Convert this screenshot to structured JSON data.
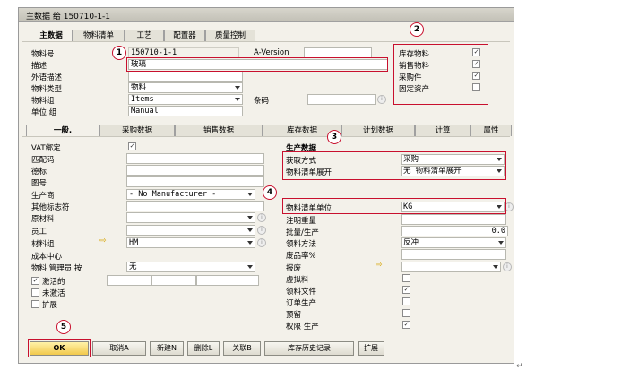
{
  "window": {
    "title": "主数据 给 150710-1-1"
  },
  "main_tabs": [
    "主数据",
    "物料清单",
    "工艺",
    "配置器",
    "质量控制"
  ],
  "header": {
    "item_no_label": "物料号",
    "item_no_value": "150710-1-1",
    "version_label": "A-Version",
    "desc_label": "描述",
    "desc_value": "玻璃",
    "foreign_desc_label": "外语描述",
    "item_type_label": "物料类型",
    "item_type_value": "物料",
    "item_group_label": "物料组",
    "item_group_value": "Items",
    "barcode_label": "条码",
    "uom_group_label": "单位 组",
    "uom_group_value": "Manual"
  },
  "flags": [
    {
      "label": "库存物料",
      "checked": true,
      "mark": "✓"
    },
    {
      "label": "销售物料",
      "checked": true,
      "mark": "✓"
    },
    {
      "label": "采购件",
      "checked": true,
      "mark": "✓"
    },
    {
      "label": "固定资产",
      "checked": false,
      "mark": ""
    }
  ],
  "sub_tabs": [
    "一般.",
    "采购数据",
    "销售数据",
    "库存数据",
    "计划数据",
    "计算",
    "属性"
  ],
  "general": {
    "vat_label": "VAT绑定",
    "vat_mark": "✓",
    "matchcode_label": "匹配码",
    "mark_label": "德标",
    "drawing_label": "图号",
    "manufacturer_label": "生产商",
    "manufacturer_value": "- No Manufacturer -",
    "other_id_label": "其他标志符",
    "raw_material_label": "原材料",
    "employee_label": "员工",
    "material_group_label": "材料组",
    "material_group_value": "HM",
    "cost_center_label": "成本中心",
    "mgmt_label": "物料 管理员 按",
    "mgmt_value": "无"
  },
  "status_options": [
    {
      "label": "激活的",
      "mark": "✓"
    },
    {
      "label": "未激活",
      "mark": ""
    },
    {
      "label": "扩展",
      "mark": ""
    }
  ],
  "production": {
    "header": "生产数据",
    "procurement_label": "获取方式",
    "procurement_value": "采购",
    "bom_expand_label": "物料清单展开",
    "bom_expand_value": "无 物料清单展开",
    "bom_unit_label": "物料清单单位",
    "bom_unit_value": "KG",
    "weight_label": "注明重量",
    "batch_label": "批量/生产",
    "batch_value": "0.0",
    "issue_method_label": "领料方法",
    "issue_method_value": "反冲",
    "scrap_label": "废品率%",
    "warehouse_label": "报废",
    "phantom_label": "虚拟料",
    "issue_doc_label": "领料文件",
    "issue_doc_mark": "✓",
    "order_prod_label": "订单生产",
    "reserve_label": "预留",
    "auth_label": "权限 生产",
    "auth_mark": "✓"
  },
  "buttons": {
    "ok": "OK",
    "cancel": "取消A",
    "new": "新建N",
    "delete": "删除L",
    "related": "关联B",
    "history": "库存历史记录",
    "extend": "扩展"
  },
  "callouts": [
    "1",
    "2",
    "3",
    "4",
    "5"
  ],
  "colors": {
    "highlight_border": "#c8102e",
    "ok_button": "#f2c94c",
    "arrow": "#d6a400"
  }
}
